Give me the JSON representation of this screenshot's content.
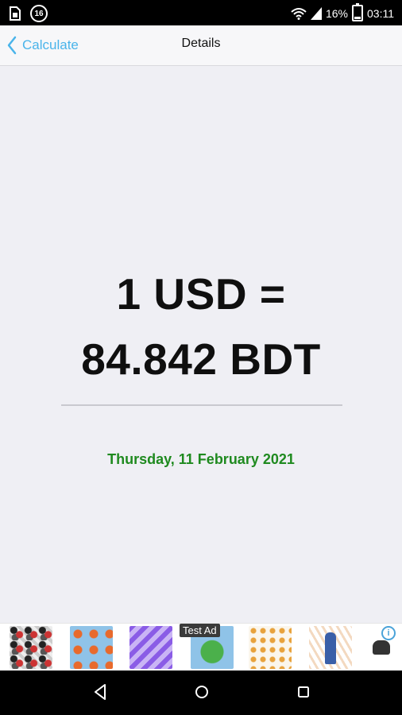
{
  "status_bar": {
    "notification_badge": "16",
    "battery_percent": "16%",
    "time": "03:11",
    "icons": [
      "sim-card-icon",
      "wifi-icon",
      "signal-icon",
      "battery-icon"
    ]
  },
  "nav": {
    "back_label": "Calculate",
    "title": "Details",
    "accent_color": "#4ab4ea"
  },
  "result": {
    "line1": "1 USD =",
    "line2": "84.842 BDT",
    "date": "Thursday, 11 February 2021",
    "date_color": "#1f8a1f"
  },
  "ad": {
    "label": "Test Ad",
    "info_glyph": "i"
  },
  "android_nav": [
    "back-icon",
    "home-icon",
    "recents-icon"
  ]
}
